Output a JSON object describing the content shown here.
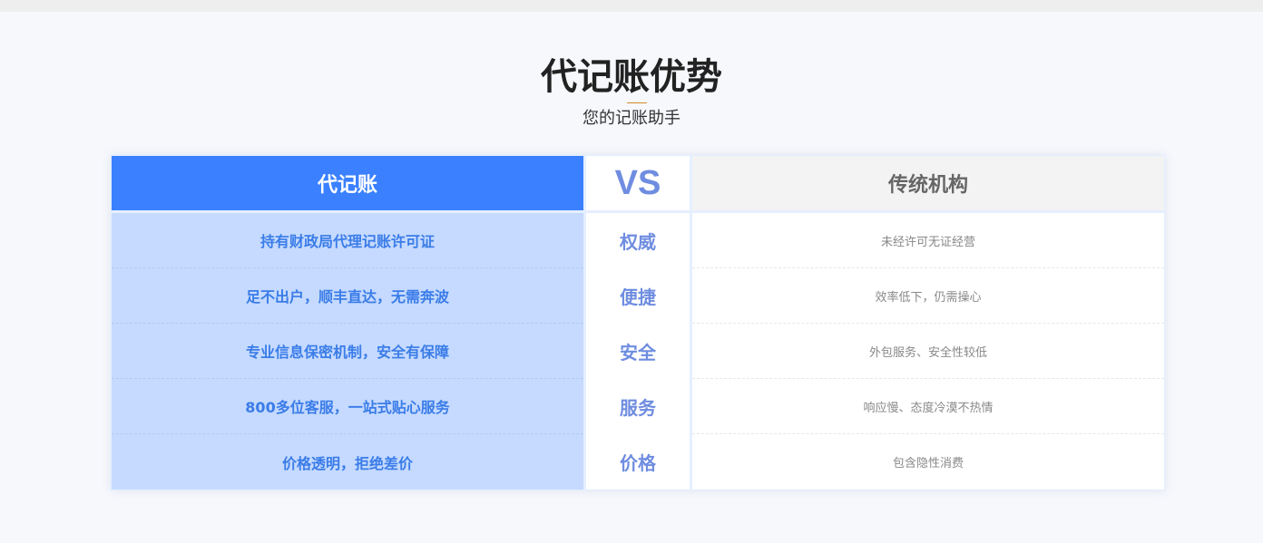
{
  "section": {
    "title": "代记账优势",
    "subtitle": "您的记账助手"
  },
  "comparison": {
    "left_header": "代记账",
    "vs_label": "VS",
    "right_header": "传统机构",
    "rows": [
      {
        "ours": "持有财政局代理记账许可证",
        "aspect": "权威",
        "theirs": "未经许可无证经营"
      },
      {
        "ours": "足不出户，顺丰直达，无需奔波",
        "aspect": "便捷",
        "theirs": "效率低下，仍需操心"
      },
      {
        "ours": "专业信息保密机制，安全有保障",
        "aspect": "安全",
        "theirs": "外包服务、安全性较低"
      },
      {
        "ours": "800多位客服，一站式贴心服务",
        "aspect": "服务",
        "theirs": "响应慢、态度冷漠不热情"
      },
      {
        "ours": "价格透明，拒绝差价",
        "aspect": "价格",
        "theirs": "包含隐性消费"
      }
    ]
  },
  "colors": {
    "accent_blue": "#3a80ff",
    "light_blue": "#c5dafe",
    "vs_color": "#6f8de0",
    "title_underline": "#d28a2a"
  }
}
